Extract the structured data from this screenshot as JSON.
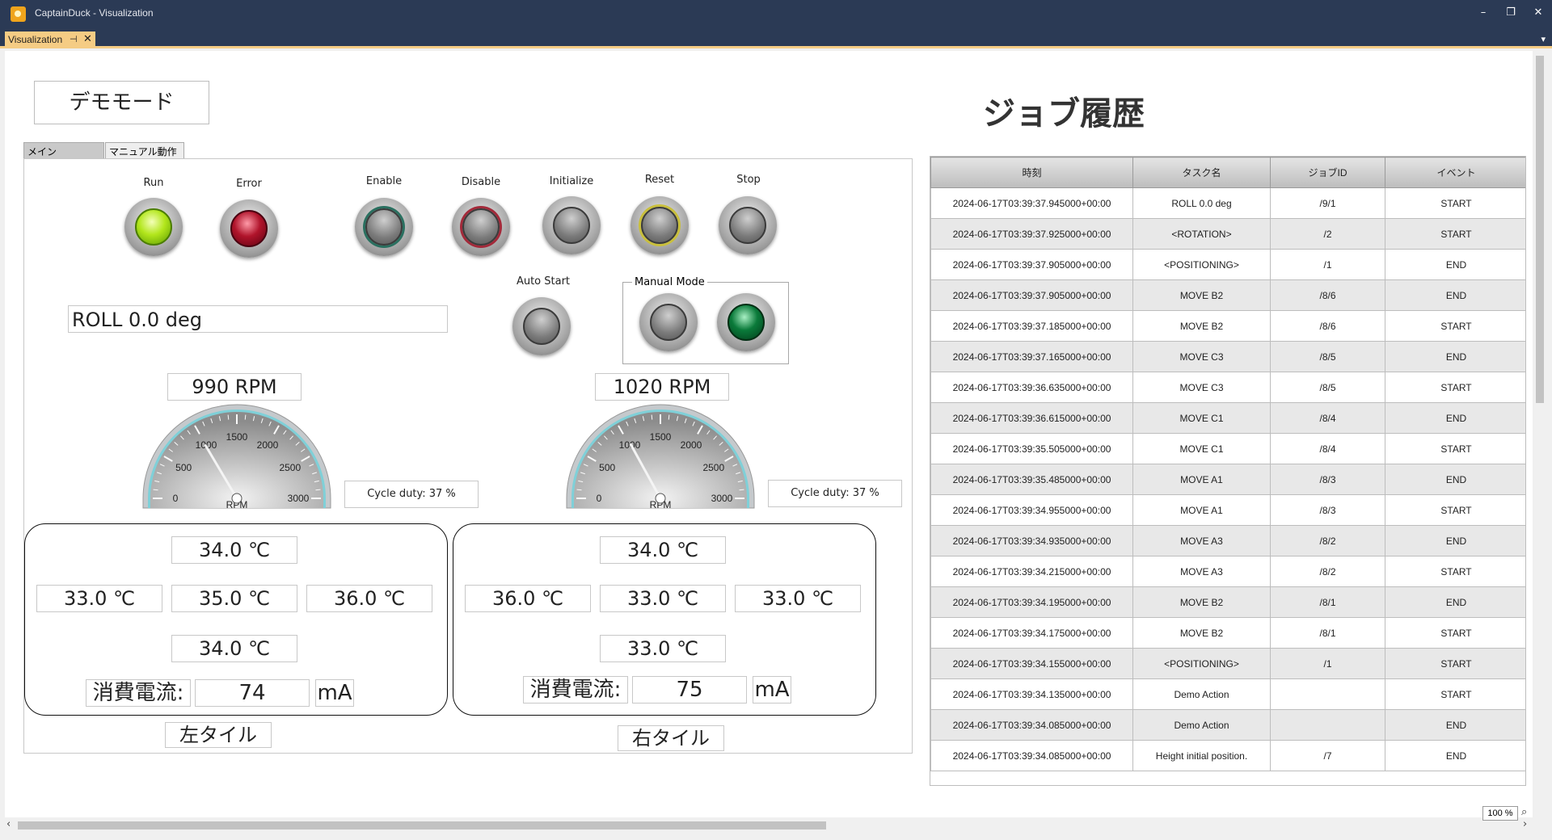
{
  "window": {
    "title": "CaptainDuck - Visualization",
    "minimize": "–",
    "restore": "❐",
    "close": "✕"
  },
  "doc_tab": {
    "label": "Visualization",
    "pin": "⊣",
    "close": "✕",
    "menu_arrow": "▾"
  },
  "mode_label": "デモモード",
  "job_history_title": "ジョブ履歴",
  "panel_tabs": {
    "main": "メイン",
    "manual": "マニュアル動作"
  },
  "lamps": {
    "run": "Run",
    "error": "Error",
    "enable": "Enable",
    "disable": "Disable",
    "initialize": "Initialize",
    "reset": "Reset",
    "stop": "Stop",
    "auto_start": "Auto Start",
    "manual_mode": "Manual Mode"
  },
  "status_text": "ROLL 0.0 deg",
  "left_motor": {
    "rpm_text": "990 RPM",
    "rpm_value": 990,
    "duty_text": "Cycle duty:  37 %"
  },
  "right_motor": {
    "rpm_text": "1020 RPM",
    "rpm_value": 1020,
    "duty_text": "Cycle duty:  37 %"
  },
  "gauge": {
    "unit": "RPM",
    "ticks": [
      "0",
      "500",
      "1000",
      "1500",
      "2000",
      "2500",
      "3000"
    ],
    "max": 3000
  },
  "left_tile": {
    "name": "左タイル",
    "temps": {
      "top": "34.0 ℃",
      "left": "33.0 ℃",
      "center": "35.0 ℃",
      "right": "36.0 ℃",
      "bottom": "34.0 ℃"
    },
    "current_label": "消費電流:",
    "current_value": "74",
    "current_unit": "mA"
  },
  "right_tile": {
    "name": "右タイル",
    "temps": {
      "top": "34.0 ℃",
      "left": "36.0 ℃",
      "center": "33.0 ℃",
      "right": "33.0 ℃",
      "bottom": "33.0 ℃"
    },
    "current_label": "消費電流:",
    "current_value": "75",
    "current_unit": "mA"
  },
  "job_table": {
    "columns": [
      "時刻",
      "タスク名",
      "ジョブID",
      "イベント"
    ],
    "rows": [
      [
        "2024-06-17T03:39:37.945000+00:00",
        "ROLL 0.0 deg",
        "/9/1",
        "START"
      ],
      [
        "2024-06-17T03:39:37.925000+00:00",
        "<ROTATION>",
        "/2",
        "START"
      ],
      [
        "2024-06-17T03:39:37.905000+00:00",
        "<POSITIONING>",
        "/1",
        "END"
      ],
      [
        "2024-06-17T03:39:37.905000+00:00",
        "MOVE B2",
        "/8/6",
        "END"
      ],
      [
        "2024-06-17T03:39:37.185000+00:00",
        "MOVE B2",
        "/8/6",
        "START"
      ],
      [
        "2024-06-17T03:39:37.165000+00:00",
        "MOVE C3",
        "/8/5",
        "END"
      ],
      [
        "2024-06-17T03:39:36.635000+00:00",
        "MOVE C3",
        "/8/5",
        "START"
      ],
      [
        "2024-06-17T03:39:36.615000+00:00",
        "MOVE C1",
        "/8/4",
        "END"
      ],
      [
        "2024-06-17T03:39:35.505000+00:00",
        "MOVE C1",
        "/8/4",
        "START"
      ],
      [
        "2024-06-17T03:39:35.485000+00:00",
        "MOVE A1",
        "/8/3",
        "END"
      ],
      [
        "2024-06-17T03:39:34.955000+00:00",
        "MOVE A1",
        "/8/3",
        "START"
      ],
      [
        "2024-06-17T03:39:34.935000+00:00",
        "MOVE A3",
        "/8/2",
        "END"
      ],
      [
        "2024-06-17T03:39:34.215000+00:00",
        "MOVE A3",
        "/8/2",
        "START"
      ],
      [
        "2024-06-17T03:39:34.195000+00:00",
        "MOVE B2",
        "/8/1",
        "END"
      ],
      [
        "2024-06-17T03:39:34.175000+00:00",
        "MOVE B2",
        "/8/1",
        "START"
      ],
      [
        "2024-06-17T03:39:34.155000+00:00",
        "<POSITIONING>",
        "/1",
        "START"
      ],
      [
        "2024-06-17T03:39:34.135000+00:00",
        "Demo Action",
        "",
        "START"
      ],
      [
        "2024-06-17T03:39:34.085000+00:00",
        "Demo Action",
        "",
        "END"
      ],
      [
        "2024-06-17T03:39:34.085000+00:00",
        "Height initial position.",
        "/7",
        "END"
      ]
    ]
  },
  "zoom": "100 %"
}
